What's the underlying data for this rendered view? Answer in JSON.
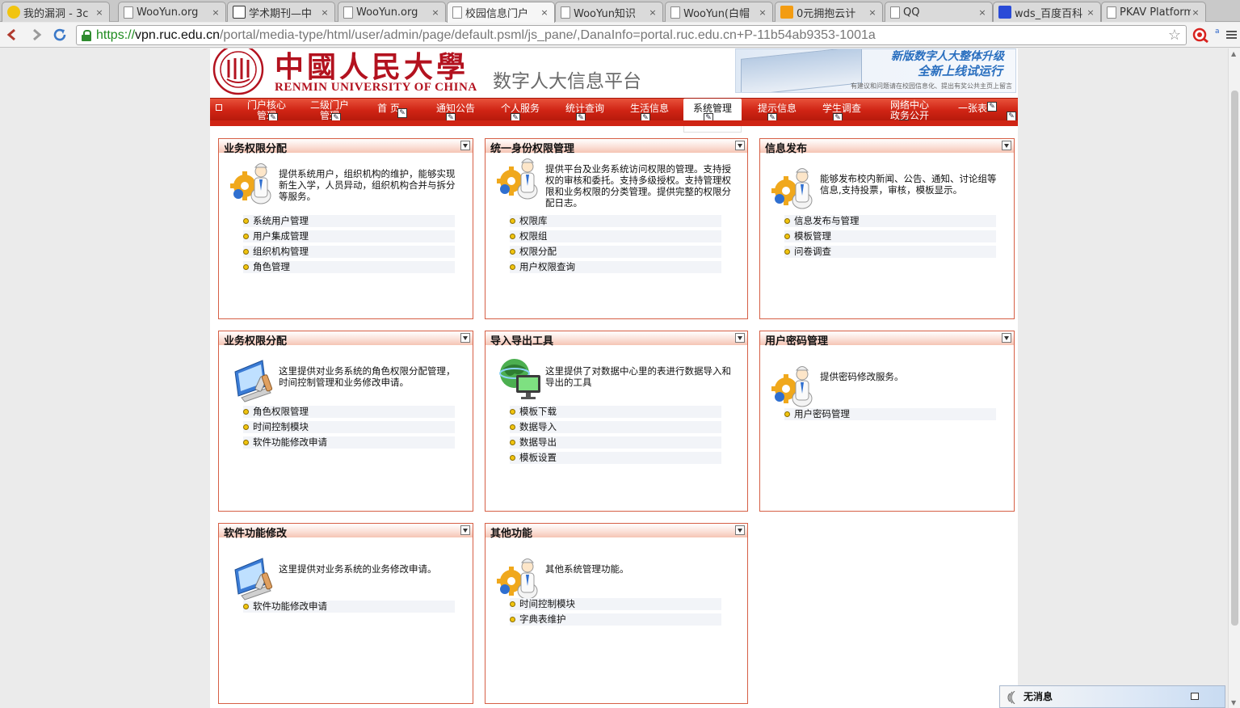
{
  "browser": {
    "tabs": [
      {
        "label": "我的漏洞 - 3c",
        "favicon": "wooyun-ball-icon",
        "active": false
      },
      {
        "label": "WooYun.org",
        "favicon": "document-icon",
        "active": false
      },
      {
        "label": "学术期刊—中",
        "favicon": "journal-icon",
        "active": false
      },
      {
        "label": "WooYun.org",
        "favicon": "document-icon",
        "active": false
      },
      {
        "label": "校园信息门户",
        "favicon": "document-icon",
        "active": true
      },
      {
        "label": "WooYun知识",
        "favicon": "document-icon",
        "active": false
      },
      {
        "label": "WooYun(白帽",
        "favicon": "document-icon",
        "active": false
      },
      {
        "label": "0元拥抱云计",
        "favicon": "cloud-icon",
        "active": false
      },
      {
        "label": "QQ",
        "favicon": "document-icon",
        "active": false
      },
      {
        "label": "wds_百度百科",
        "favicon": "baidu-paw-icon",
        "active": false
      },
      {
        "label": "PKAV Platform",
        "favicon": "document-icon",
        "active": false
      }
    ],
    "close_glyph": "×",
    "url": {
      "scheme": "https://",
      "host": "vpn.ruc.edu.cn",
      "path": "/portal/media-type/html/user/admin/page/default.psml/js_pane/,DanaInfo=portal.ruc.edu.cn+P-11b54ab9353-1001a"
    },
    "star_glyph": "☆"
  },
  "header": {
    "university_cn": "中國人民大學",
    "university_en": "RENMIN UNIVERSITY OF CHINA",
    "platform_title": "数字人大信息平台",
    "promo": {
      "line1": "新版数字人大整体升级",
      "line2": "全新上线试运行",
      "line3": "有建议和问题请在校园信息化、提出有奖公共主页上留言"
    }
  },
  "nav": {
    "items": [
      {
        "line1": "门户核心",
        "line2": "管理",
        "active": false
      },
      {
        "line1": "二级门户",
        "line2": "管理",
        "active": false
      },
      {
        "line1": "首 页",
        "line2": "",
        "active": false
      },
      {
        "line1": "通知公告",
        "line2": "",
        "active": false
      },
      {
        "line1": "个人服务",
        "line2": "",
        "active": false
      },
      {
        "line1": "统计查询",
        "line2": "",
        "active": false
      },
      {
        "line1": "生活信息",
        "line2": "",
        "active": false
      },
      {
        "line1": "系统管理",
        "line2": "",
        "active": true
      },
      {
        "line1": "提示信息",
        "line2": "",
        "active": false
      },
      {
        "line1": "学生调查",
        "line2": "",
        "active": false
      },
      {
        "line1": "网络中心",
        "line2": "政务公开",
        "active": false
      },
      {
        "line1": "一张表",
        "line2": "",
        "active": false
      }
    ],
    "edit_glyph": "✎"
  },
  "portlets": [
    {
      "title": "业务权限分配",
      "icon": "admin-gear-icon",
      "desc": "提供系统用户，组织机构的维护，能够实现新生入学，人员异动，组织机构合并与拆分等服务。",
      "links": [
        "系统用户管理",
        "用户集成管理",
        "组织机构管理",
        "角色管理"
      ]
    },
    {
      "title": "统一身份权限管理",
      "icon": "admin-gear-icon",
      "desc": "提供平台及业务系统访问权限的管理。支持授权的审核和委托。支持多级授权。支持管理权限和业务权限的分类管理。提供完整的权限分配日志。",
      "links": [
        "权限库",
        "权限组",
        "权限分配",
        "用户权限查询"
      ]
    },
    {
      "title": "信息发布",
      "icon": "admin-gear-icon",
      "desc": "能够发布校内新闻、公告、通知、讨论组等信息,支持投票，审核，模板显示。",
      "links": [
        "信息发布与管理",
        "模板管理",
        "问卷调查"
      ]
    },
    {
      "title": "业务权限分配",
      "icon": "computer-tools-icon",
      "desc": "这里提供对业务系统的角色权限分配管理，时间控制管理和业务修改申请。",
      "links": [
        "角色权限管理",
        "时间控制模块",
        "软件功能修改申请"
      ]
    },
    {
      "title": "导入导出工具",
      "icon": "globe-monitor-icon",
      "desc": "这里提供了对数据中心里的表进行数据导入和导出的工具",
      "links": [
        "模板下载",
        "数据导入",
        "数据导出",
        "模板设置"
      ]
    },
    {
      "title": "用户密码管理",
      "icon": "admin-gear-icon",
      "desc": "提供密码修改服务。",
      "links": [
        "用户密码管理"
      ]
    },
    {
      "title": "软件功能修改",
      "icon": "computer-tools-icon",
      "desc": "这里提供对业务系统的业务修改申请。",
      "links": [
        "软件功能修改申请"
      ]
    },
    {
      "title": "其他功能",
      "icon": "admin-gear-icon",
      "desc": "其他系统管理功能。",
      "links": [
        "时间控制模块",
        "字典表维护"
      ]
    }
  ],
  "notifier": {
    "text": "无消息"
  },
  "colors": {
    "nav_red": "#cf2414",
    "portlet_border": "#d65f45",
    "brand_red": "#b3121f",
    "https_green": "#1e8b1e"
  }
}
